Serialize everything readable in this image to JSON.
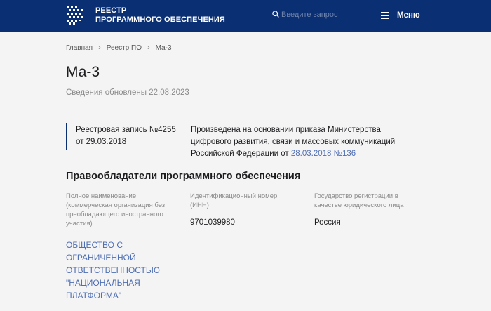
{
  "header": {
    "brand_line1": "РЕЕСТР",
    "brand_line2": "ПРОГРАММНОГО ОБЕСПЕЧЕНИЯ",
    "search_placeholder": "Введите запрос",
    "menu_label": "Меню",
    "bg_color": "#0b2f73"
  },
  "breadcrumb": {
    "items": [
      "Главная",
      "Реестр ПО",
      "Ма-3"
    ]
  },
  "page": {
    "title": "Ма-3",
    "updated": "Сведения обновлены 22.08.2023"
  },
  "registry": {
    "record_line1": "Реестровая запись №4255",
    "record_line2": "от 29.03.2018",
    "basis_text": "Произведена на основании приказа Министерства цифрового развития, связи и массовых коммуникаций Российской Федерации от ",
    "basis_link": "28.03.2018 №136"
  },
  "owners": {
    "section_title": "Правообладатели программного обеспечения",
    "columns": [
      {
        "label": "Полное наименование (коммерческая организация без преобладающего иностранного участия)",
        "value": "ОБЩЕСТВО С ОГРАНИЧЕННОЙ ОТВЕТСТВЕННОСТЬЮ \"НАЦИОНАЛЬНАЯ ПЛАТФОРМА\""
      },
      {
        "label": "Идентификационный номер (ИНН)",
        "value": "9701039980"
      },
      {
        "label": "Государство регистрации в качестве юридического лица",
        "value": "Россия"
      }
    ]
  },
  "colors": {
    "accent": "#0b2f73",
    "link": "#4f6fb3",
    "divider": "#9fb4d6"
  }
}
